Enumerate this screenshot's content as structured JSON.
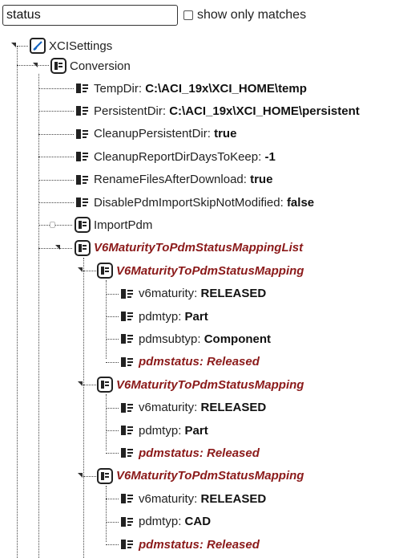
{
  "search": {
    "value": "status"
  },
  "filter": {
    "label": "show only matches"
  },
  "tree": {
    "root": "XCISettings",
    "conversion": "Conversion",
    "settings": [
      {
        "key": "TempDir",
        "value": "C:\\ACI_19x\\XCI_HOME\\temp"
      },
      {
        "key": "PersistentDir",
        "value": "C:\\ACI_19x\\XCI_HOME\\persistent"
      },
      {
        "key": "CleanupPersistentDir",
        "value": "true"
      },
      {
        "key": "CleanupReportDirDaysToKeep",
        "value": "-1"
      },
      {
        "key": "RenameFilesAfterDownload",
        "value": "true"
      },
      {
        "key": "DisablePdmImportSkipNotModified",
        "value": "false"
      }
    ],
    "import_pdm": "ImportPdm",
    "mapping_list": "V6MaturityToPdmStatusMappingList",
    "mapping_name": "V6MaturityToPdmStatusMapping",
    "mappings": [
      {
        "fields": [
          {
            "key": "v6maturity",
            "value": "RELEASED"
          },
          {
            "key": "pdmtyp",
            "value": "Part"
          },
          {
            "key": "pdmsubtyp",
            "value": "Component"
          }
        ],
        "status": "pdmstatus: Released"
      },
      {
        "fields": [
          {
            "key": "v6maturity",
            "value": "RELEASED"
          },
          {
            "key": "pdmtyp",
            "value": "Part"
          }
        ],
        "status": "pdmstatus: Released"
      },
      {
        "fields": [
          {
            "key": "v6maturity",
            "value": "RELEASED"
          },
          {
            "key": "pdmtyp",
            "value": "CAD"
          }
        ],
        "status": "pdmstatus: Released"
      }
    ]
  },
  "colors": {
    "match": "#8b1a1a",
    "line": "#444444"
  },
  "icons": {
    "root": "xcisettings-icon",
    "node": "node-icon",
    "leaf": "leaf-icon"
  }
}
